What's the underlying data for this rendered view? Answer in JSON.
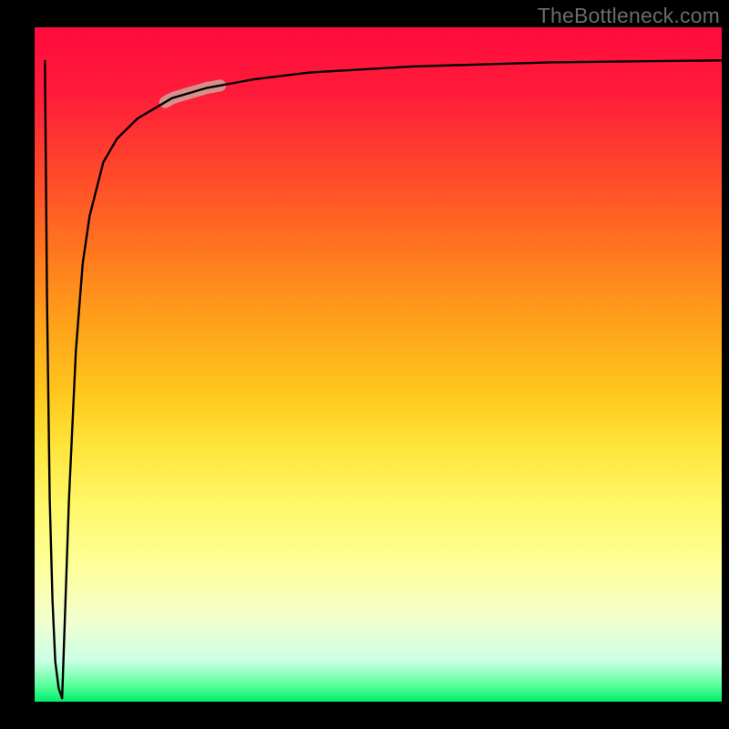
{
  "watermark": "TheBottleneck.com",
  "chart_data": {
    "type": "line",
    "title": "",
    "xlabel": "",
    "ylabel": "",
    "xlim": [
      0,
      100
    ],
    "ylim": [
      0,
      100
    ],
    "grid": false,
    "series": [
      {
        "name": "left-edge-drop",
        "x": [
          1.5,
          1.8,
          2.2,
          2.6,
          3.0,
          3.5,
          4.0
        ],
        "values": [
          95,
          60,
          30,
          15,
          6,
          2,
          0.5
        ]
      },
      {
        "name": "main-curve",
        "x": [
          4.0,
          5,
          6,
          7,
          8,
          10,
          12,
          15,
          20,
          25,
          32,
          40,
          55,
          75,
          100
        ],
        "values": [
          0.5,
          30,
          52,
          65,
          72,
          80,
          83.5,
          86.5,
          89.5,
          91,
          92.3,
          93.3,
          94.2,
          94.8,
          95.1
        ]
      }
    ],
    "annotations": [
      {
        "name": "highlight-segment",
        "x_range": [
          19,
          27
        ],
        "y_range": [
          82.5,
          86
        ]
      }
    ],
    "background_gradient": {
      "top": "#ff0a3c",
      "mid": "#ffe43a",
      "bottom": "#00ef6b"
    }
  }
}
